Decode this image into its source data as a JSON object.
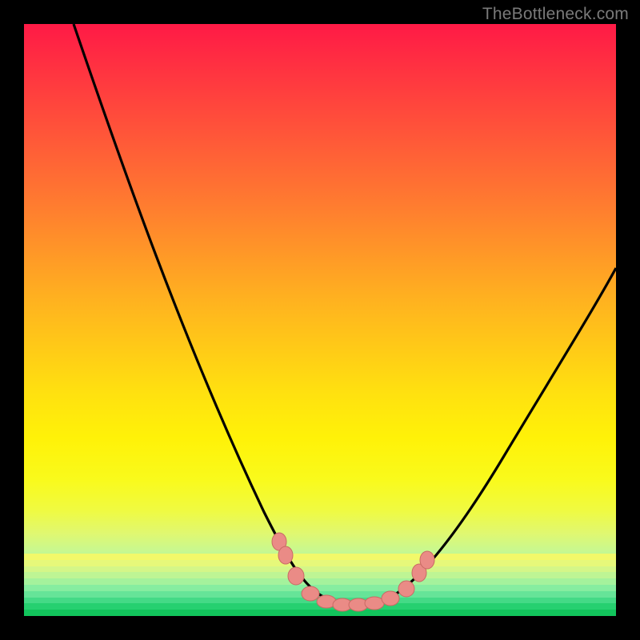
{
  "watermark": "TheBottleneck.com",
  "chart_data": {
    "type": "line",
    "title": "",
    "xlabel": "",
    "ylabel": "",
    "xlim": [
      0,
      100
    ],
    "ylim": [
      0,
      100
    ],
    "series": [
      {
        "name": "bottleneck-curve",
        "x": [
          10,
          15,
          20,
          25,
          30,
          35,
          40,
          43,
          45,
          47,
          49,
          51,
          53,
          55,
          57,
          60,
          65,
          70,
          75,
          80,
          85,
          90,
          95,
          100
        ],
        "y": [
          100,
          90,
          79,
          68,
          57,
          46,
          34,
          25,
          18,
          12,
          7,
          4,
          3,
          3,
          4,
          6,
          11,
          18,
          26,
          34,
          42,
          49,
          55,
          60
        ]
      }
    ],
    "markers": [
      {
        "x": 43,
        "y": 20
      },
      {
        "x": 44,
        "y": 15
      },
      {
        "x": 45.5,
        "y": 11
      },
      {
        "x": 48,
        "y": 5
      },
      {
        "x": 50,
        "y": 3
      },
      {
        "x": 52,
        "y": 3
      },
      {
        "x": 54,
        "y": 3
      },
      {
        "x": 56,
        "y": 3
      },
      {
        "x": 58,
        "y": 4
      },
      {
        "x": 61,
        "y": 7
      },
      {
        "x": 63,
        "y": 11
      },
      {
        "x": 64.5,
        "y": 14
      }
    ],
    "gradient_stops": [
      {
        "pos": 0,
        "color": "#ff1a46"
      },
      {
        "pos": 50,
        "color": "#ffc818"
      },
      {
        "pos": 80,
        "color": "#f0fa40"
      },
      {
        "pos": 100,
        "color": "#1ad060"
      }
    ]
  }
}
